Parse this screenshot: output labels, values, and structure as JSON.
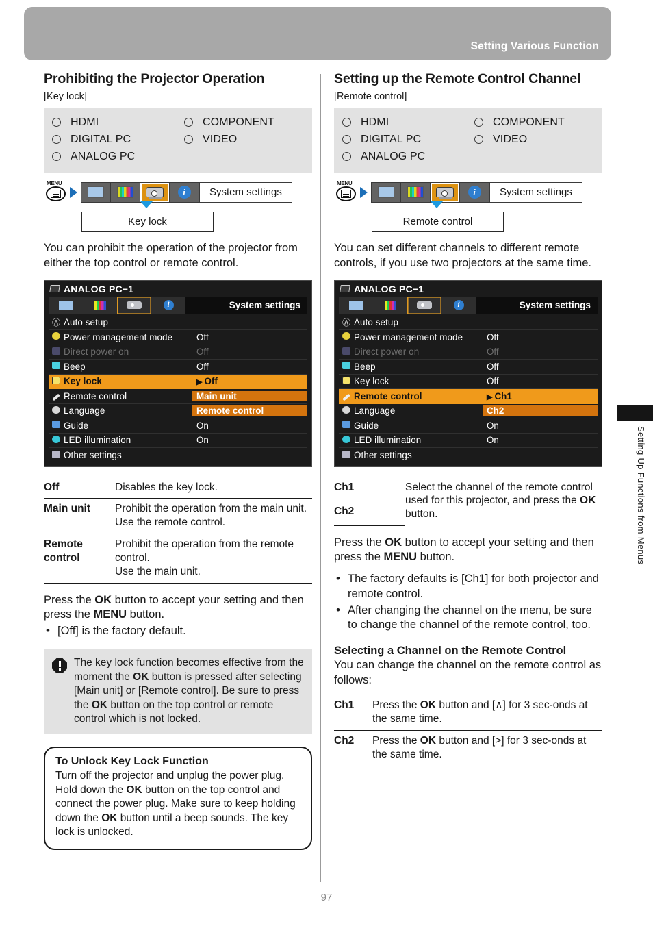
{
  "header": {
    "title": "Setting Various Function"
  },
  "footer": {
    "page_number": "97"
  },
  "thumb_tab": {
    "label": "Setting Up Functions from Menus"
  },
  "left": {
    "section_title": "Prohibiting the Projector Operation",
    "section_sub": "[Key lock]",
    "inputs": {
      "col1": [
        "HDMI",
        "DIGITAL PC",
        "ANALOG PC"
      ],
      "col2": [
        "COMPONENT",
        "VIDEO"
      ]
    },
    "menu_path": {
      "menu_button_label": "MENU",
      "system_settings": "System settings",
      "target": "Key lock"
    },
    "intro": "You can prohibit the operation of the projector from either the top control or remote control.",
    "osd": {
      "title": "ANALOG PC−1",
      "system_settings": "System settings",
      "rows": [
        {
          "icon": "A",
          "name": "Auto setup",
          "value": "",
          "state": "normal"
        },
        {
          "icon": "bulb",
          "name": "Power management mode",
          "value": "Off",
          "state": "normal"
        },
        {
          "icon": "grid",
          "name": "Direct power on",
          "value": "Off",
          "state": "dim"
        },
        {
          "icon": "spk",
          "name": "Beep",
          "value": "Off",
          "state": "normal"
        },
        {
          "icon": "lock",
          "name": "Key lock",
          "value": "Off",
          "state": "highlight"
        },
        {
          "icon": "pen",
          "name": "Remote control",
          "value": "Main unit",
          "state": "option"
        },
        {
          "icon": "bub",
          "name": "Language",
          "value": "Remote control",
          "state": "option"
        },
        {
          "icon": "book",
          "name": "Guide",
          "value": "On",
          "state": "normal"
        },
        {
          "icon": "led",
          "name": "LED illumination",
          "value": "On",
          "state": "normal"
        },
        {
          "icon": "oth",
          "name": "Other settings",
          "value": "",
          "state": "normal"
        }
      ]
    },
    "table": [
      {
        "term": "Off",
        "desc": "Disables the key lock."
      },
      {
        "term": "Main unit",
        "desc": "Prohibit the operation from the main unit.\nUse the remote control."
      },
      {
        "term": "Remote control",
        "desc": "Prohibit the operation from the remote control.\nUse the main unit."
      }
    ],
    "press_ok_pre": "Press the ",
    "press_ok_ok": "OK",
    "press_ok_mid": " button to accept your setting and then press the ",
    "press_ok_menu": "MENU",
    "press_ok_post": " button.",
    "factory_default_bullet": "[Off] is the factory default.",
    "notice": {
      "p1": "The key lock function becomes effective from the moment the ",
      "ok1": "OK",
      "p2": " button is pressed after selecting [Main unit] or [Remote control]. Be sure to press the ",
      "ok2": "OK",
      "p3": " button on the top control or remote control which is not locked."
    },
    "tipbox": {
      "title": "To Unlock Key Lock Function",
      "p1": "Turn off the projector and unplug the power plug. Hold down the ",
      "ok1": "OK",
      "p2": " button on the top control and connect the power plug. Make sure to keep holding down the ",
      "ok2": "OK",
      "p3": " button until a beep sounds. The key lock is unlocked."
    }
  },
  "right": {
    "section_title": "Setting up the Remote Control Channel",
    "section_sub": "[Remote control]",
    "inputs": {
      "col1": [
        "HDMI",
        "DIGITAL PC",
        "ANALOG PC"
      ],
      "col2": [
        "COMPONENT",
        "VIDEO"
      ]
    },
    "menu_path": {
      "menu_button_label": "MENU",
      "system_settings": "System settings",
      "target": "Remote control"
    },
    "intro": "You can set different channels to different remote controls, if you use two projectors at the same time.",
    "osd": {
      "title": "ANALOG PC−1",
      "system_settings": "System settings",
      "rows": [
        {
          "icon": "A",
          "name": "Auto setup",
          "value": "",
          "state": "normal"
        },
        {
          "icon": "bulb",
          "name": "Power management mode",
          "value": "Off",
          "state": "normal"
        },
        {
          "icon": "grid",
          "name": "Direct power on",
          "value": "Off",
          "state": "dim"
        },
        {
          "icon": "spk",
          "name": "Beep",
          "value": "Off",
          "state": "normal"
        },
        {
          "icon": "lock",
          "name": "Key lock",
          "value": "Off",
          "state": "normal"
        },
        {
          "icon": "pen",
          "name": "Remote control",
          "value": "Ch1",
          "state": "highlight"
        },
        {
          "icon": "bub",
          "name": "Language",
          "value": "Ch2",
          "state": "option"
        },
        {
          "icon": "book",
          "name": "Guide",
          "value": "On",
          "state": "normal"
        },
        {
          "icon": "led",
          "name": "LED illumination",
          "value": "On",
          "state": "normal"
        },
        {
          "icon": "oth",
          "name": "Other settings",
          "value": "",
          "state": "normal"
        }
      ]
    },
    "channel_table": {
      "term1": "Ch1",
      "term2": "Ch2",
      "desc_pre": "Select the channel of the remote control used for this projector, and press the ",
      "desc_ok": "OK",
      "desc_post": " button."
    },
    "press_ok_pre": "Press the ",
    "press_ok_ok": "OK",
    "press_ok_mid": " button to accept your setting and then press the ",
    "press_ok_menu": "MENU",
    "press_ok_post": " button.",
    "bullets": [
      "The factory defaults is [Ch1] for both projector and remote control.",
      "After changing the channel on the menu, be sure to change the channel of the remote control, too."
    ],
    "sub_head": "Selecting a Channel on the Remote Control",
    "sub_intro": "You can change the channel on the remote control as follows:",
    "remote_table": [
      {
        "term": "Ch1",
        "pre": "Press the ",
        "ok": "OK",
        "post": " button and [∧] for 3 sec-onds at the same time."
      },
      {
        "term": "Ch2",
        "pre": "Press the ",
        "ok": "OK",
        "post": " button and [>] for 3 sec-onds at the same time."
      }
    ]
  },
  "colors": {
    "header_band": "#a8a8a8",
    "input_box_bg": "#e2e2e2",
    "osd_bg": "#1b1b1b",
    "osd_highlight": "#f09a1b",
    "osd_option": "#d4740e",
    "tab_selected": "#dd9211",
    "menu_arrow_blue": "#1d6fb8",
    "caret_blue": "#1d9ae0"
  }
}
